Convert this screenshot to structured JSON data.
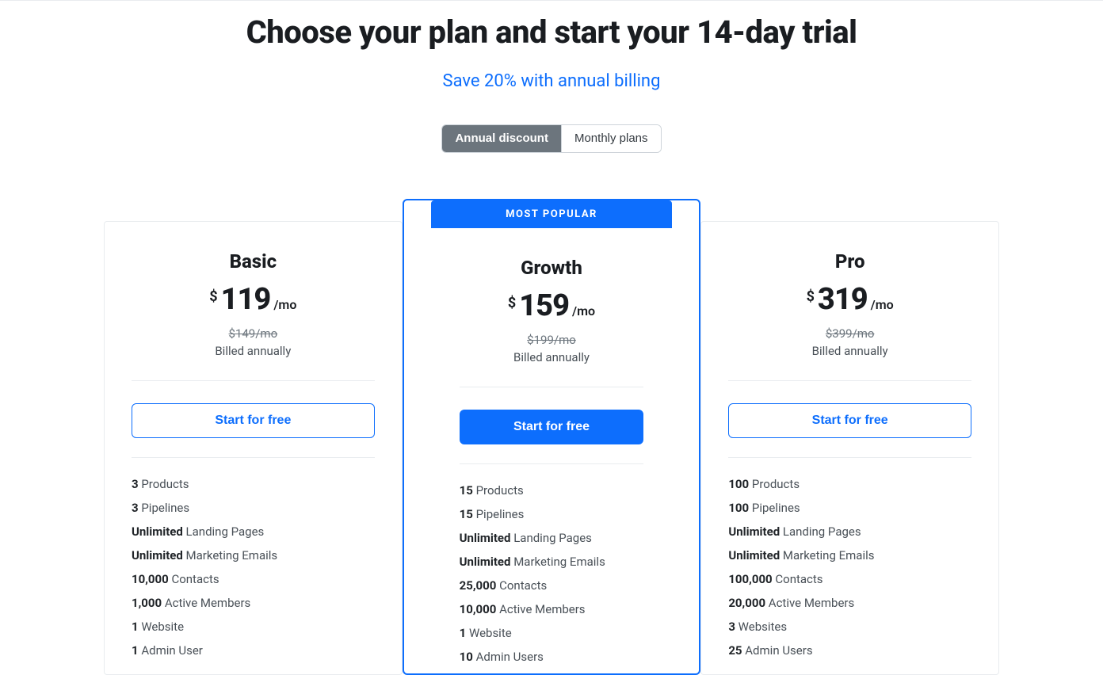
{
  "header": {
    "title": "Choose your plan and start your 14-day trial",
    "subtitle": "Save 20% with annual billing"
  },
  "toggle": {
    "annual": "Annual discount",
    "monthly": "Monthly plans"
  },
  "common": {
    "currency": "$",
    "per": "/mo",
    "billed": "Billed annually",
    "cta": "Start for free",
    "badge": "MOST POPULAR"
  },
  "plans": [
    {
      "name": "Basic",
      "price": "119",
      "strike": "$149/mo",
      "features": [
        {
          "bold": "3",
          "text": " Products"
        },
        {
          "bold": "3",
          "text": " Pipelines"
        },
        {
          "bold": "Unlimited",
          "text": " Landing Pages"
        },
        {
          "bold": "Unlimited",
          "text": " Marketing Emails"
        },
        {
          "bold": "10,000",
          "text": " Contacts"
        },
        {
          "bold": "1,000",
          "text": " Active Members"
        },
        {
          "bold": "1",
          "text": " Website"
        },
        {
          "bold": "1",
          "text": " Admin User"
        }
      ]
    },
    {
      "name": "Growth",
      "price": "159",
      "strike": "$199/mo",
      "features": [
        {
          "bold": "15",
          "text": " Products"
        },
        {
          "bold": "15",
          "text": " Pipelines"
        },
        {
          "bold": "Unlimited",
          "text": " Landing Pages"
        },
        {
          "bold": "Unlimited",
          "text": " Marketing Emails"
        },
        {
          "bold": "25,000",
          "text": " Contacts"
        },
        {
          "bold": "10,000",
          "text": " Active Members"
        },
        {
          "bold": "1",
          "text": " Website"
        },
        {
          "bold": "10",
          "text": " Admin Users"
        }
      ]
    },
    {
      "name": "Pro",
      "price": "319",
      "strike": "$399/mo",
      "features": [
        {
          "bold": "100",
          "text": " Products"
        },
        {
          "bold": "100",
          "text": " Pipelines"
        },
        {
          "bold": "Unlimited",
          "text": " Landing Pages"
        },
        {
          "bold": "Unlimited",
          "text": " Marketing Emails"
        },
        {
          "bold": "100,000",
          "text": " Contacts"
        },
        {
          "bold": "20,000",
          "text": " Active Members"
        },
        {
          "bold": "3",
          "text": " Websites"
        },
        {
          "bold": "25",
          "text": " Admin Users"
        }
      ]
    }
  ]
}
